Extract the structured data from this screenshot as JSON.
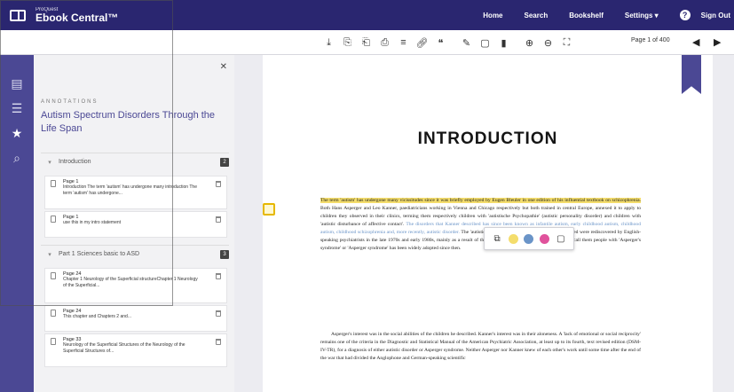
{
  "topbar": {
    "brand_small": "ProQuest",
    "brand_title": "Ebook Central™",
    "nav": [
      "Home",
      "Search",
      "Bookshelf",
      "Settings ▾"
    ],
    "help_glyph": "?",
    "signout": "Sign Out"
  },
  "toolbar": {
    "tools": [
      "download-icon",
      "pdf-chapter-icon",
      "pdf-page-icon",
      "print-icon",
      "share-icon",
      "link-icon",
      "cite-icon",
      "highlight-icon",
      "note-icon",
      "bookmark-icon",
      "zoom-in-icon",
      "zoom-out-icon",
      "fit-page-icon"
    ],
    "page_indicator": "Page 1 of 400",
    "prev_glyph": "◀",
    "next_glyph": "▶"
  },
  "rail": [
    "contents-icon",
    "list-icon",
    "annotations-star-icon",
    "search-icon"
  ],
  "panel": {
    "close_glyph": "✕",
    "kicker": "ANNOTATIONS",
    "book_title": "Autism Spectrum Disorders Through the Life Span",
    "sections": [
      {
        "label": "Introduction",
        "count": "2"
      },
      {
        "label": "Part 1 Sciences basic to ASD",
        "count": "3"
      }
    ],
    "notes": [
      {
        "title": "Page 1",
        "text": "Introduction The term 'autism' has undergone many introduction The term 'autism' has undergone..."
      },
      {
        "title": "Page 1",
        "text": "use this in my intro statement"
      },
      {
        "title": "Page 24",
        "text": "Chapter 1 Neurology of the Superficial structureChapter 1 Neurology of the Superficial..."
      },
      {
        "title": "Page 24",
        "text": "This chapter and Chapters 2 and..."
      },
      {
        "title": "Page 33",
        "text": "Neurology of the Superficial Structures of the Neurology of the Superficial Structures of..."
      }
    ]
  },
  "reader": {
    "chapter_title": "INTRODUCTION",
    "p1_highlight": "The term 'autism' has undergone many vicissitudes since it was briefly employed by Eugen Bleuler in one edition of his influential textbook on schizophrenia.",
    "p1_rest": " Both Hans Asperger and Leo Kanner, paediatricians working in Vienna and Chicago respectively but both trained in central Europe, annexed it to apply to children they observed in their clinics, terming them respectively children with 'autistische Psychopathie' (autistic personality disorder) and children with 'autistic disturbance of affective contact'.",
    "p1_blue": " The disorders that Kanner described has since been known as infantile autism, early childhood autism, childhood autism, childhood schizophrenia and, more recently, autistic disorder.",
    "p1_end": " The 'autistic personality disorders' that Asperger described were rediscovered by English-speaking psychiatrists in the late 1970s and early 1980s, mainly as a result of the work of Lorna Wing, and her proposal to call them people with 'Asperger's syndrome' or 'Asperger syndrome' has been widely adopted since then.",
    "p2": "Asperger's interest was in the social abilities of the children he described. Kanner's interest was in their aloneness. A 'lack of emotional or social reciprocity' remains one of the criteria in the Diagnostic and Statistical Manual of the American Psychiatric Association, at least up to its fourth, text revised edition (DSM-IV-TR), for a diagnosis of either autistic disorder or Asperger syndrome. Neither Asperger nor Kanner knew of each other's work until some time after the end of the war that had divided the Anglophone and German-speaking scientific",
    "popover": [
      "copy-icon",
      "yellow-highlight",
      "blue-highlight",
      "pink-highlight",
      "add-note-icon"
    ]
  },
  "colors": {
    "topbar": "#2a2670",
    "rail": "#4b4894",
    "accent_title": "#4b4894",
    "highlight_yellow": "#f4dd6c",
    "highlight_blue": "#6a94c8",
    "highlight_pink": "#e0529c",
    "note_marker": "#e6b800"
  }
}
